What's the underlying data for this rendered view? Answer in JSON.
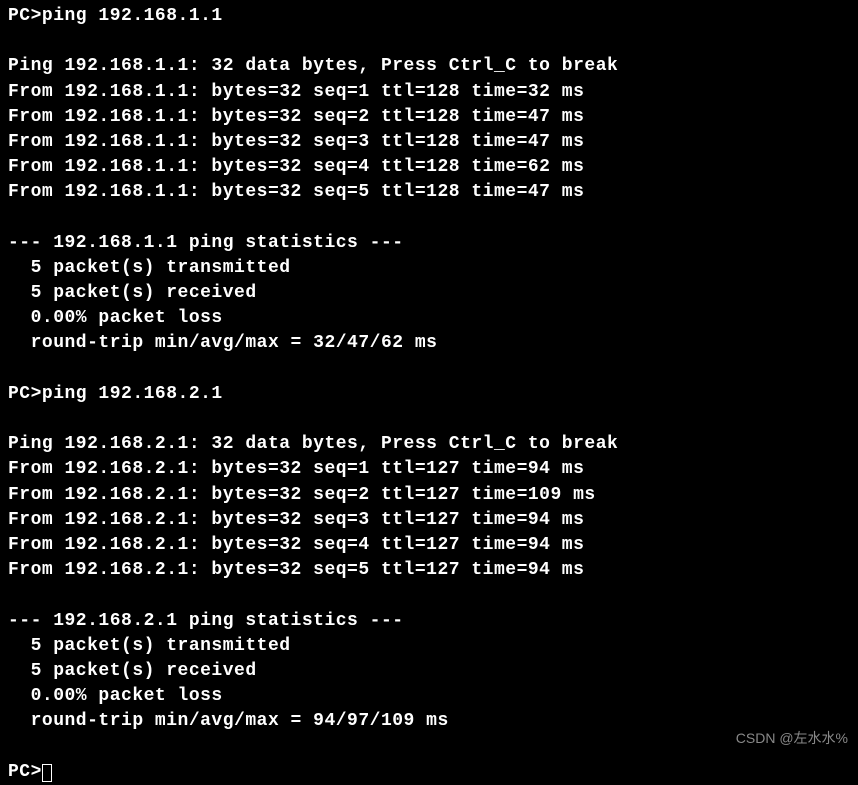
{
  "topCmd": "PC>ping 192.168.1.1",
  "session1": {
    "header": "Ping 192.168.1.1: 32 data bytes, Press Ctrl_C to break",
    "replies": [
      "From 192.168.1.1: bytes=32 seq=1 ttl=128 time=32 ms",
      "From 192.168.1.1: bytes=32 seq=2 ttl=128 time=47 ms",
      "From 192.168.1.1: bytes=32 seq=3 ttl=128 time=47 ms",
      "From 192.168.1.1: bytes=32 seq=4 ttl=128 time=62 ms",
      "From 192.168.1.1: bytes=32 seq=5 ttl=128 time=47 ms"
    ],
    "statsHeader": "--- 192.168.1.1 ping statistics ---",
    "transmitted": "  5 packet(s) transmitted",
    "received": "  5 packet(s) received",
    "loss": "  0.00% packet loss",
    "rtt": "  round-trip min/avg/max = 32/47/62 ms"
  },
  "cmd2": "PC>ping 192.168.2.1",
  "session2": {
    "header": "Ping 192.168.2.1: 32 data bytes, Press Ctrl_C to break",
    "replies": [
      "From 192.168.2.1: bytes=32 seq=1 ttl=127 time=94 ms",
      "From 192.168.2.1: bytes=32 seq=2 ttl=127 time=109 ms",
      "From 192.168.2.1: bytes=32 seq=3 ttl=127 time=94 ms",
      "From 192.168.2.1: bytes=32 seq=4 ttl=127 time=94 ms",
      "From 192.168.2.1: bytes=32 seq=5 ttl=127 time=94 ms"
    ],
    "statsHeader": "--- 192.168.2.1 ping statistics ---",
    "transmitted": "  5 packet(s) transmitted",
    "received": "  5 packet(s) received",
    "loss": "  0.00% packet loss",
    "rtt": "  round-trip min/avg/max = 94/97/109 ms"
  },
  "prompt": "PC>",
  "watermark": "CSDN @左水水%"
}
